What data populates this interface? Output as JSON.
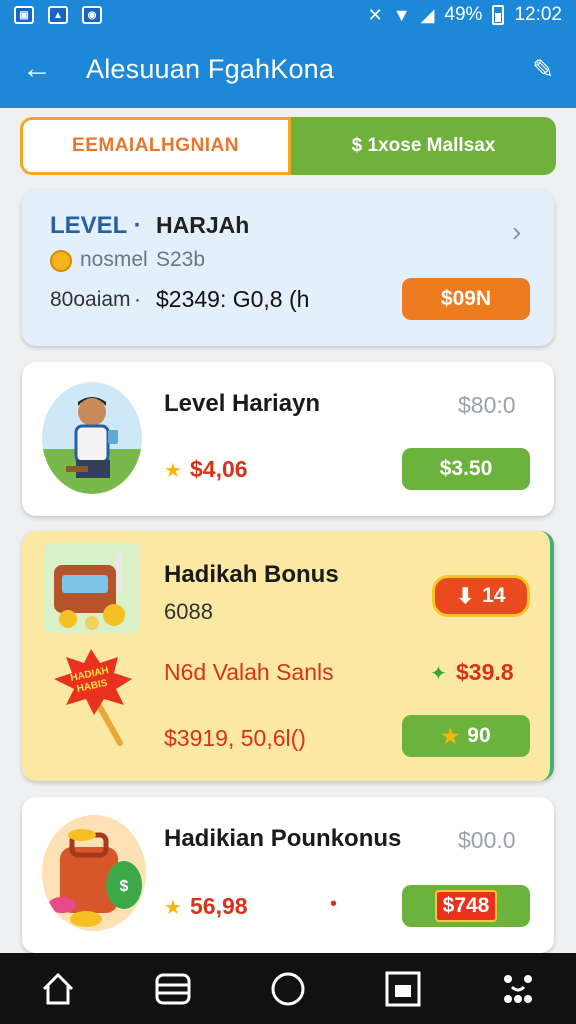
{
  "statusbar": {
    "signal": "49%",
    "time": "12:02"
  },
  "appbar": {
    "title": "Alesuuan FgahKona"
  },
  "tabs": [
    {
      "label": "EEMAIALHGNIAN"
    },
    {
      "label": "$ 1xose Mallsax"
    }
  ],
  "card1": {
    "level_label": "LEVEL ·",
    "level_name": "HARJAh",
    "sub_label": "nosmel",
    "sub_value": "S23b",
    "foot_label": "80oaiam",
    "foot_value": "$2349: G0,8 (h",
    "button": "$09N"
  },
  "card2": {
    "title": "Level Hariayn",
    "price": "$80:0",
    "stars": "$4,06",
    "button": "$3.50"
  },
  "card3": {
    "title": "Hadikah Bonus",
    "subtitle": "6088",
    "badge": "14",
    "sticker": "HADIAH HABIS",
    "line_label": "N6d Valah Sanls",
    "line_value": "$39.8",
    "foot_value": "$3919, 50,6l()",
    "button": "90"
  },
  "card4": {
    "title": "Hadikian Pounkonus",
    "price": "$00.0",
    "stars": "56,98",
    "button": "$748",
    "bag_mark": "$"
  },
  "navbar": {
    "items": [
      "home-icon",
      "menu-icon",
      "circle-icon",
      "recents-icon",
      "grid-icon"
    ]
  },
  "colors": {
    "primary": "#1e88d8",
    "green": "#6cb33e",
    "orange": "#ee7b1e"
  }
}
